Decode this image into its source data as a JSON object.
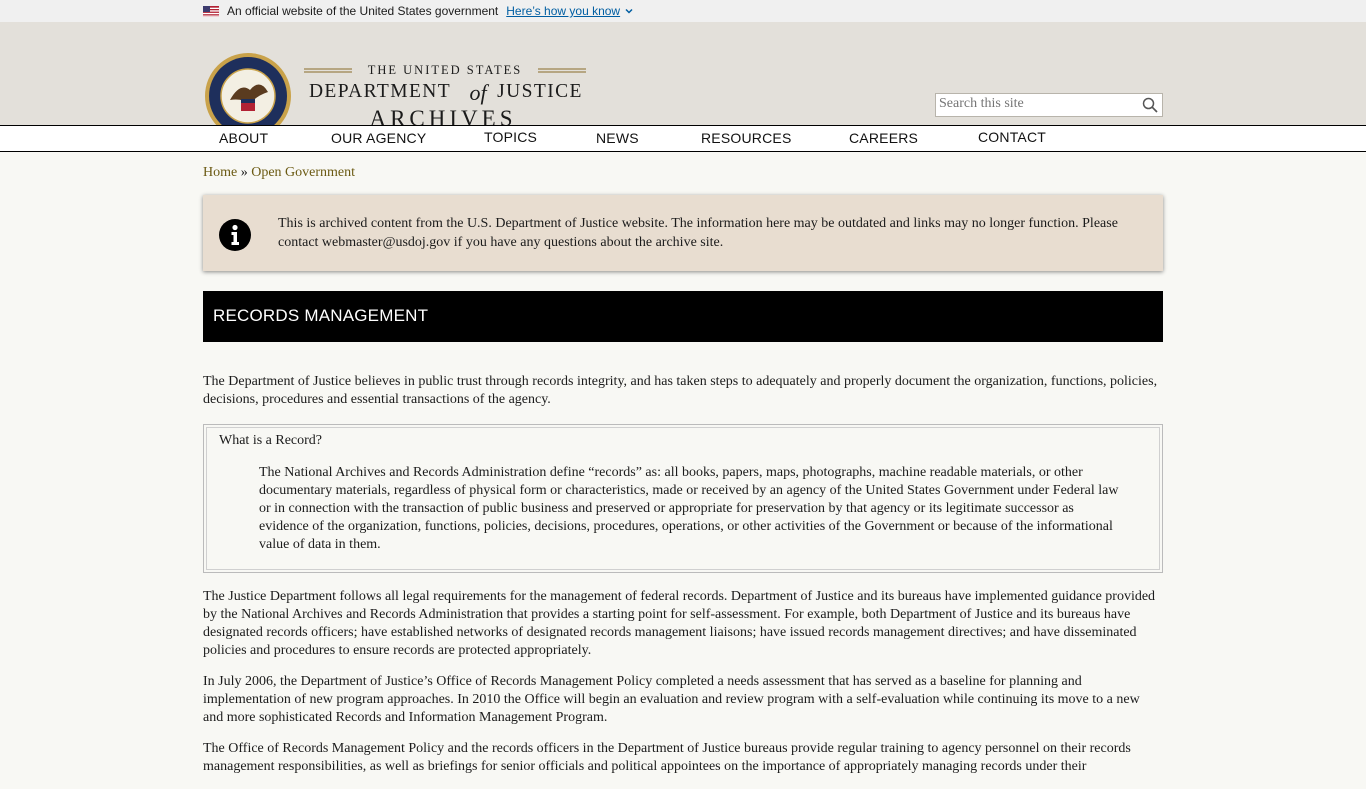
{
  "gov_banner": {
    "text": "An official website of the United States government",
    "link": "Here’s how you know"
  },
  "header": {
    "line1": "THE UNITED STATES",
    "line2_a": "DEPARTMENT",
    "line2_of": "of",
    "line2_b": "JUSTICE",
    "line3": "ARCHIVES",
    "search_placeholder": "Search this site"
  },
  "nav": [
    "ABOUT",
    "OUR AGENCY",
    "TOPICS",
    "NEWS",
    "RESOURCES",
    "CAREERS",
    "CONTACT"
  ],
  "breadcrumb": {
    "home": "Home",
    "sep": "»",
    "current": "Open Government"
  },
  "notice": "This is archived content from the U.S. Department of Justice website. The information here may be outdated and links may no longer function. Please contact webmaster@usdoj.gov if you have any questions about the archive site.",
  "page_title": "RECORDS MANAGEMENT",
  "intro": "The Department of Justice believes in public trust through records integrity, and has taken steps to adequately and properly document the organization, functions, policies, decisions, procedures and essential transactions of the agency.",
  "record_box": {
    "question": "What is a Record?",
    "definition": "The National Archives and Records Administration define “records” as: all books, papers, maps, photographs, machine readable materials, or other documentary materials, regardless of physical form or characteristics, made or received by an agency of the United States Government under Federal law or in connection with the transaction of public business and preserved or appropriate for preservation by that agency or its legitimate successor as evidence of the organization, functions, policies, decisions, procedures, operations, or other activities of the Government or because of the informational value of data in them."
  },
  "paragraphs": [
    "The Justice Department follows all legal requirements for the management of federal records.  Department of Justice and its bureaus have implemented guidance provided by the National Archives and Records Administration that provides a starting point for self-assessment.  For example, both Department of Justice and its bureaus have designated records officers; have established networks of designated records management liaisons; have issued records management directives; and have disseminated policies and procedures to ensure records are protected appropriately.",
    "In July 2006, the Department of Justice’s Office of Records Management Policy completed a needs assessment that has served as a baseline for planning and implementation of new program approaches.  In 2010 the Office will begin an evaluation and review program with a self-evaluation while continuing its move to a new and more sophisticated Records and Information Management Program.",
    "The Office of Records Management Policy and the records officers in the Department of Justice bureaus provide regular training to agency personnel on their records management responsibilities, as well as briefings for senior officials and political appointees on the importance of appropriately managing records under their"
  ],
  "icons": {
    "flag": "us-flag-icon",
    "chevron": "chevron-down-icon",
    "seal": "doj-seal-icon",
    "search": "search-icon",
    "info": "info-icon"
  }
}
